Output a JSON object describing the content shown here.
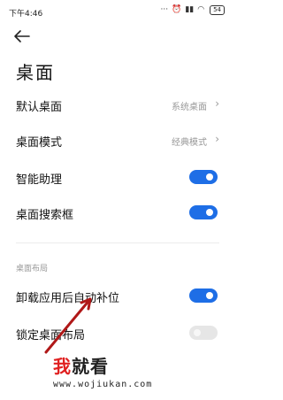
{
  "status_bar": {
    "time": "下午4:46",
    "icons": [
      "dots-icon",
      "alarm-icon",
      "signal-icon",
      "wifi-icon",
      "battery-icon"
    ],
    "battery": "54"
  },
  "header": {
    "title": "桌面"
  },
  "settings": [
    {
      "label": "默认桌面",
      "value": "系统桌面"
    },
    {
      "label": "桌面模式",
      "value": "经典模式"
    },
    {
      "label": "智能助理",
      "toggle": true
    },
    {
      "label": "桌面搜索框",
      "toggle": true
    }
  ],
  "section": {
    "title": "桌面布局",
    "items": [
      {
        "label": "卸载应用后自动补位",
        "toggle": true
      },
      {
        "label": "锁定桌面布局",
        "toggle": false
      }
    ]
  },
  "watermark": {
    "part1": "我",
    "part2": "就看",
    "url": "www.wojiukan.com"
  },
  "colors": {
    "toggle_on": "#1e6ee6",
    "toggle_off": "#e6e6e6",
    "watermark_red": "#e02020",
    "annotation_arrow": "#b01818"
  }
}
